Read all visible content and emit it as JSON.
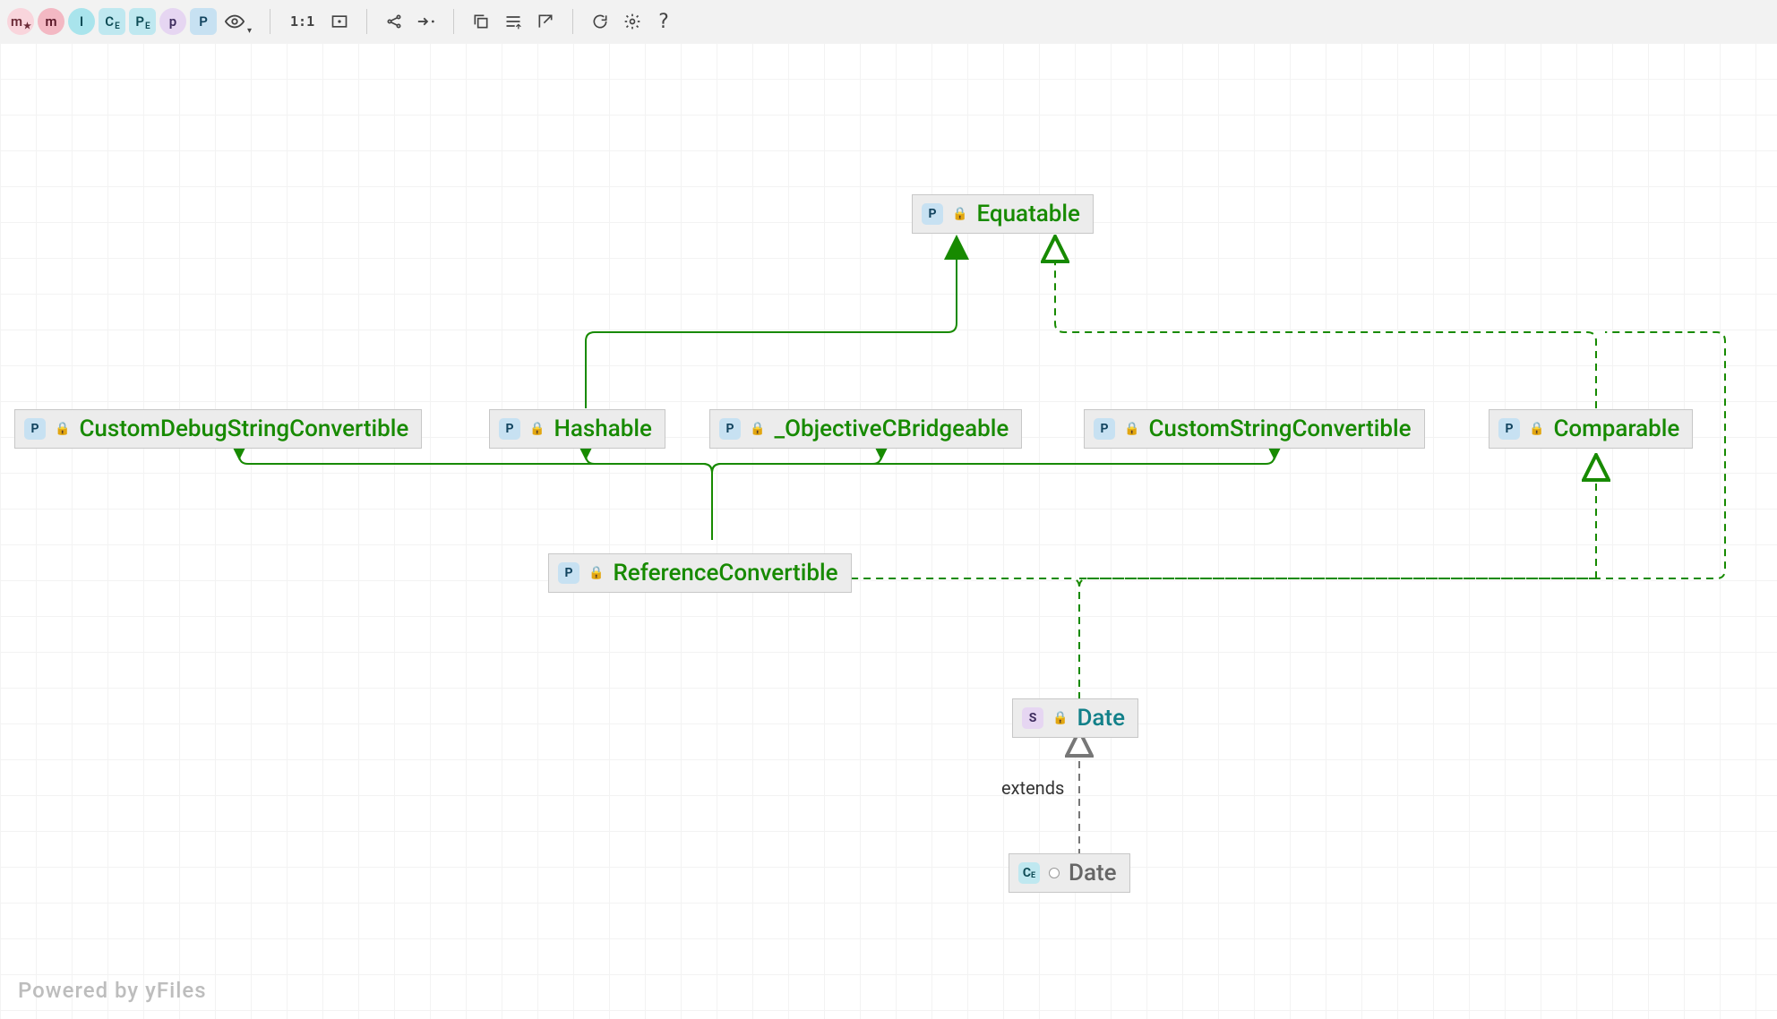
{
  "toolbar": {
    "chips": [
      {
        "name": "chip-mk",
        "label": "m",
        "sub": "★",
        "color": "pink-lt"
      },
      {
        "name": "chip-m",
        "label": "m",
        "sub": "",
        "color": "pink"
      },
      {
        "name": "chip-i",
        "label": "I",
        "sub": "",
        "color": "teal"
      },
      {
        "name": "chip-ce",
        "label": "C",
        "sub": "E",
        "color": "cyan",
        "shape": "sq"
      },
      {
        "name": "chip-pe",
        "label": "P",
        "sub": "E",
        "color": "cyan",
        "shape": "sq"
      },
      {
        "name": "chip-p-lav",
        "label": "p",
        "sub": "",
        "color": "lav"
      },
      {
        "name": "chip-p-blue",
        "label": "P",
        "sub": "",
        "color": "blue",
        "shape": "sq"
      }
    ],
    "buttons": [
      {
        "name": "eye-icon",
        "label": "👁"
      },
      {
        "name": "zoom-1to1",
        "label": "1:1"
      },
      {
        "name": "fit-screen-icon",
        "label": "⛶"
      },
      {
        "name": "share-icon",
        "label": "⑂"
      },
      {
        "name": "collapse-icon",
        "label": "→·"
      },
      {
        "name": "copy-icon",
        "label": "⧉"
      },
      {
        "name": "align-icon",
        "label": "≡ᵢ"
      },
      {
        "name": "export-icon",
        "label": "↗"
      },
      {
        "name": "refresh-icon",
        "label": "⟳"
      },
      {
        "name": "settings-icon",
        "label": "⚙"
      },
      {
        "name": "help-icon",
        "label": "?"
      }
    ]
  },
  "diagram": {
    "nodes": {
      "equatable": {
        "type": "P",
        "label": "Equatable"
      },
      "customDebugStringConvertible": {
        "type": "P",
        "label": "CustomDebugStringConvertible"
      },
      "hashable": {
        "type": "P",
        "label": "Hashable"
      },
      "objcBridgeable": {
        "type": "P",
        "label": "_ObjectiveCBridgeable"
      },
      "customStringConvertible": {
        "type": "P",
        "label": "CustomStringConvertible"
      },
      "comparable": {
        "type": "P",
        "label": "Comparable"
      },
      "referenceConvertible": {
        "type": "P",
        "label": "ReferenceConvertible"
      },
      "dateStruct": {
        "type": "S",
        "label": "Date"
      },
      "dateExt": {
        "type": "C",
        "sub": "E",
        "label": "Date"
      }
    },
    "edgeLabels": {
      "extends": "extends"
    }
  },
  "watermark": "Powered by yFiles"
}
